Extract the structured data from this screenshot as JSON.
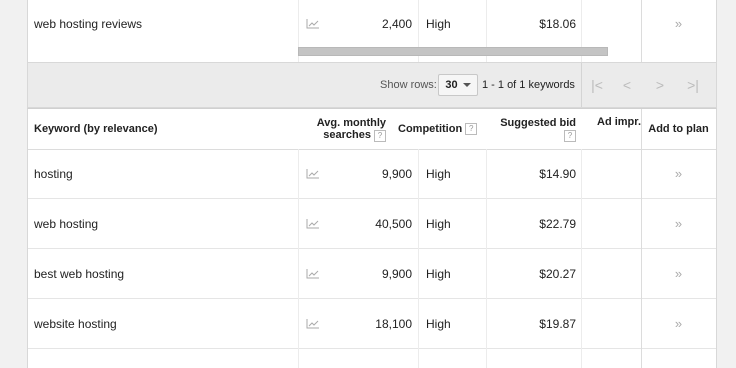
{
  "top_rows": [
    {
      "keyword": "web hosting reviews",
      "avg": "2,400",
      "competition": "High",
      "bid": "$18.06",
      "add": "»"
    }
  ],
  "pager": {
    "show_rows_label": "Show rows:",
    "rows_value": "30",
    "range_text": "1 - 1 of 1 keywords",
    "first": "|<",
    "prev": "<",
    "next": ">",
    "last": ">|"
  },
  "header": {
    "keyword": "Keyword (by relevance)",
    "avg_line1": "Avg. monthly",
    "avg_line2": "searches",
    "competition": "Competition",
    "bid": "Suggested bid",
    "ad_impr": "Ad impr.",
    "add_to_plan": "Add to plan",
    "help": "?"
  },
  "rows": [
    {
      "keyword": "hosting",
      "avg": "9,900",
      "competition": "High",
      "bid": "$14.90",
      "add": "»"
    },
    {
      "keyword": "web hosting",
      "avg": "40,500",
      "competition": "High",
      "bid": "$22.79",
      "add": "»"
    },
    {
      "keyword": "best web hosting",
      "avg": "9,900",
      "competition": "High",
      "bid": "$20.27",
      "add": "»"
    },
    {
      "keyword": "website hosting",
      "avg": "18,100",
      "competition": "High",
      "bid": "$19.87",
      "add": "»"
    }
  ]
}
